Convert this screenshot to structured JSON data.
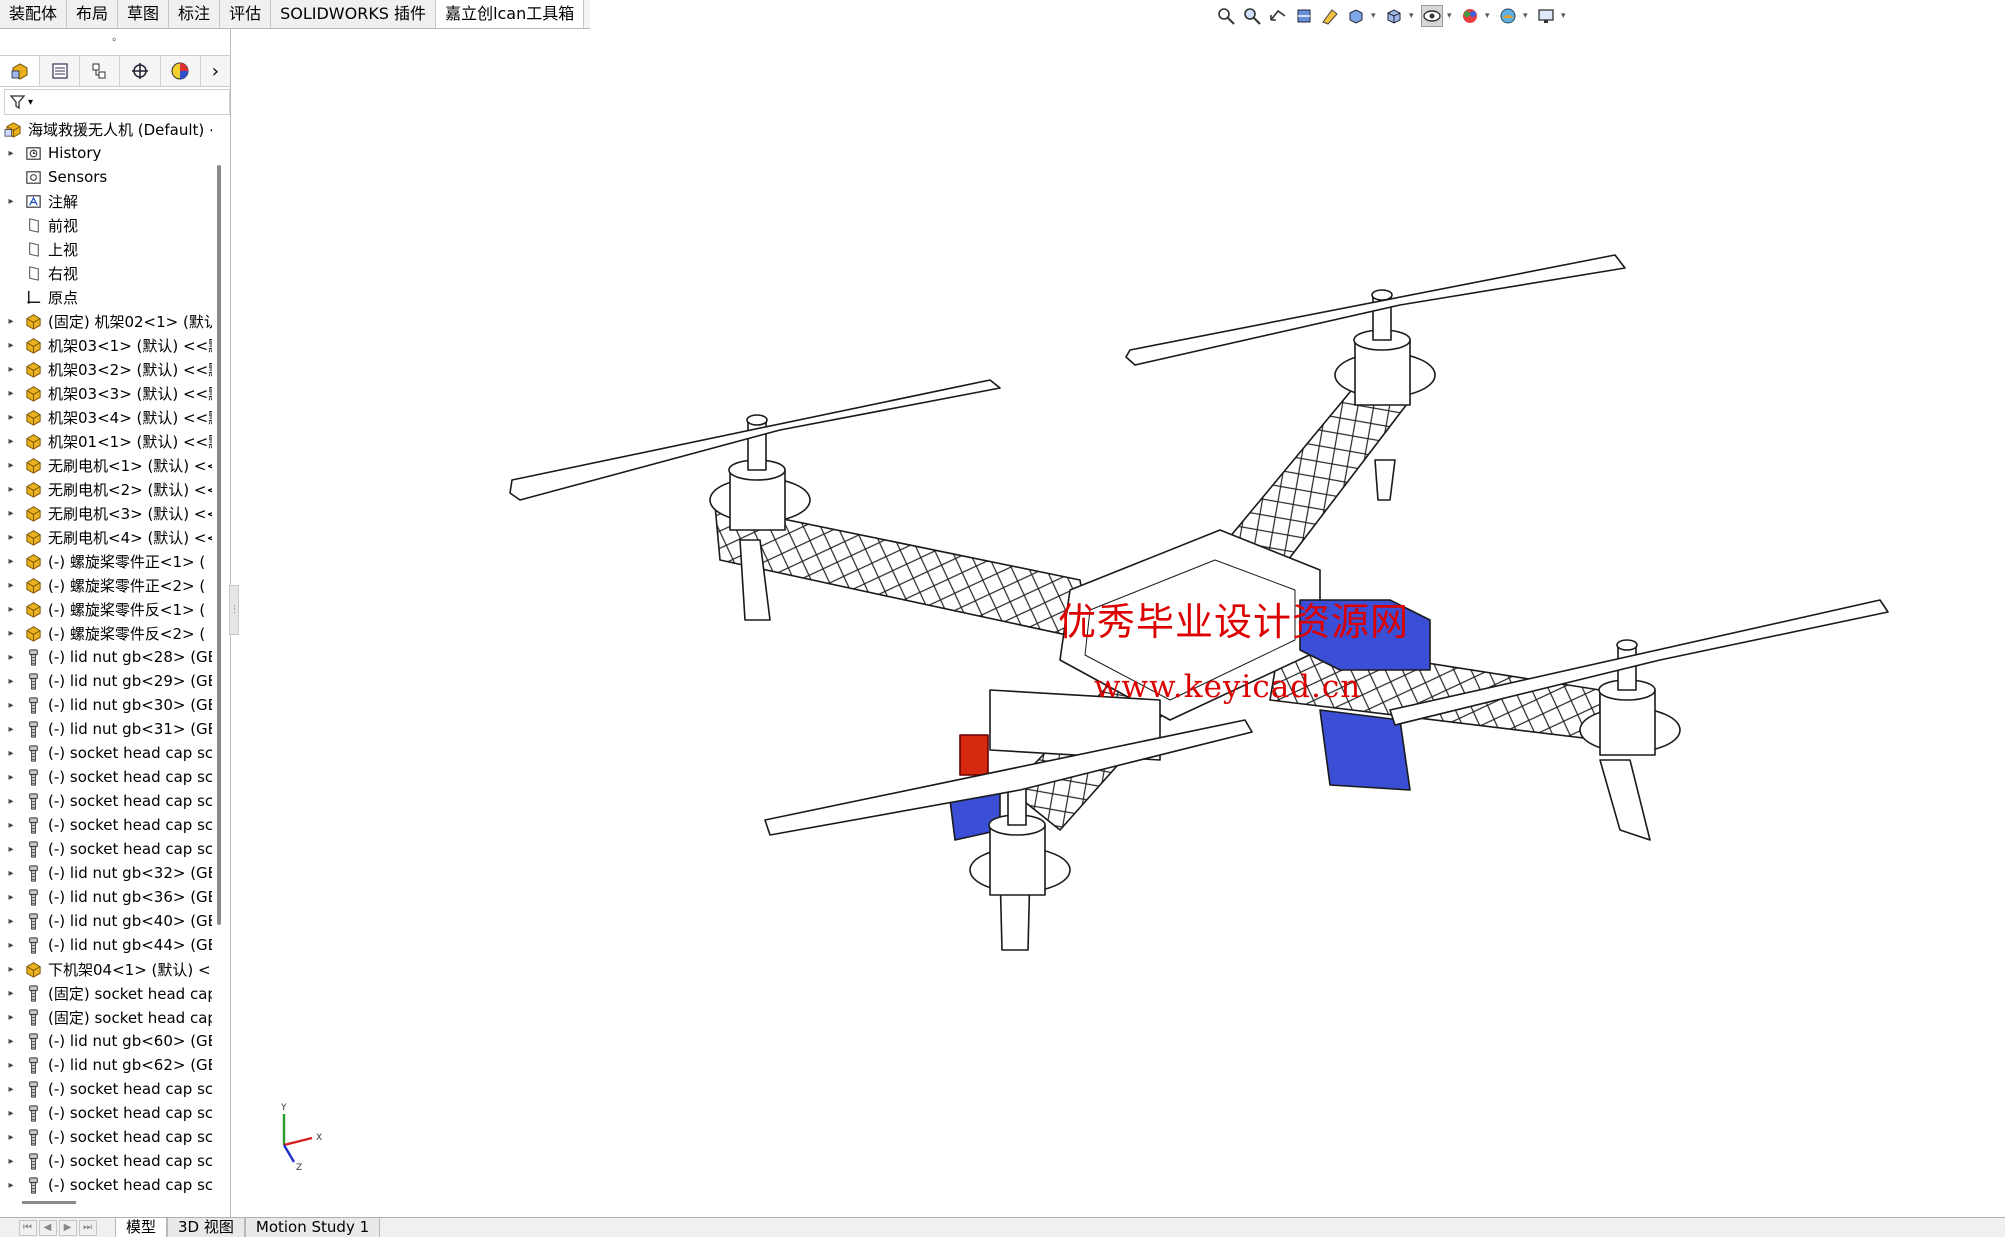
{
  "command_tabs": [
    {
      "label": "装配体"
    },
    {
      "label": "布局"
    },
    {
      "label": "草图"
    },
    {
      "label": "标注"
    },
    {
      "label": "评估"
    },
    {
      "label": "SOLIDWORKS 插件"
    },
    {
      "label": "嘉立创lcan工具箱"
    }
  ],
  "active_command_tab": 6,
  "heads_up_toolbar": [
    "zoom-to-fit-icon",
    "zoom-to-area-icon",
    "previous-view-icon",
    "section-view-icon",
    "dynamic-annotation-icon",
    "view-orientation-icon",
    "display-style-icon",
    "hide-show-items-icon",
    "edit-appearance-icon",
    "apply-scene-icon",
    "view-settings-icon"
  ],
  "manager_tabs": [
    "featuremanager-icon",
    "propertymanager-icon",
    "configurationmanager-icon",
    "dimxpertmanager-icon",
    "displaymanager-icon"
  ],
  "tree": {
    "root": "海域救援无人机 (Default) <",
    "items": [
      {
        "label": "History",
        "icon": "history",
        "expand": true
      },
      {
        "label": "Sensors",
        "icon": "sensors",
        "expand": false
      },
      {
        "label": "注解",
        "icon": "annotation",
        "expand": true
      },
      {
        "label": "前视",
        "icon": "plane",
        "expand": false
      },
      {
        "label": "上视",
        "icon": "plane",
        "expand": false
      },
      {
        "label": "右视",
        "icon": "plane",
        "expand": false
      },
      {
        "label": "原点",
        "icon": "origin",
        "expand": false
      },
      {
        "label": "(固定) 机架02<1> (默认",
        "icon": "part",
        "expand": true
      },
      {
        "label": "机架03<1> (默认) <<默",
        "icon": "part",
        "expand": true
      },
      {
        "label": "机架03<2> (默认) <<默",
        "icon": "part",
        "expand": true
      },
      {
        "label": "机架03<3> (默认) <<默",
        "icon": "part",
        "expand": true
      },
      {
        "label": "机架03<4> (默认) <<默",
        "icon": "part",
        "expand": true
      },
      {
        "label": "机架01<1> (默认) <<默",
        "icon": "part",
        "expand": true
      },
      {
        "label": "无刷电机<1> (默认) <<",
        "icon": "part",
        "expand": true
      },
      {
        "label": "无刷电机<2> (默认) <<",
        "icon": "part",
        "expand": true
      },
      {
        "label": "无刷电机<3> (默认) <<",
        "icon": "part",
        "expand": true
      },
      {
        "label": "无刷电机<4> (默认) <<",
        "icon": "part",
        "expand": true
      },
      {
        "label": "(-) 螺旋桨零件正<1> (",
        "icon": "part",
        "expand": true
      },
      {
        "label": "(-) 螺旋桨零件正<2> (",
        "icon": "part",
        "expand": true
      },
      {
        "label": "(-) 螺旋桨零件反<1> (",
        "icon": "part",
        "expand": true
      },
      {
        "label": "(-) 螺旋桨零件反<2> (",
        "icon": "part",
        "expand": true
      },
      {
        "label": "(-) lid nut gb<28> (GB",
        "icon": "toolbox",
        "expand": true
      },
      {
        "label": "(-) lid nut gb<29> (GB",
        "icon": "toolbox",
        "expand": true
      },
      {
        "label": "(-) lid nut gb<30> (GB",
        "icon": "toolbox",
        "expand": true
      },
      {
        "label": "(-) lid nut gb<31> (GB",
        "icon": "toolbox",
        "expand": true
      },
      {
        "label": "(-) socket head cap sc",
        "icon": "toolbox",
        "expand": true
      },
      {
        "label": "(-) socket head cap sc",
        "icon": "toolbox",
        "expand": true
      },
      {
        "label": "(-) socket head cap sc",
        "icon": "toolbox",
        "expand": true
      },
      {
        "label": "(-) socket head cap sc",
        "icon": "toolbox",
        "expand": true
      },
      {
        "label": "(-) socket head cap sc",
        "icon": "toolbox",
        "expand": true
      },
      {
        "label": "(-) lid nut gb<32> (GB",
        "icon": "toolbox",
        "expand": true
      },
      {
        "label": "(-) lid nut gb<36> (GB",
        "icon": "toolbox",
        "expand": true
      },
      {
        "label": "(-) lid nut gb<40> (GB",
        "icon": "toolbox",
        "expand": true
      },
      {
        "label": "(-) lid nut gb<44> (GB",
        "icon": "toolbox",
        "expand": true
      },
      {
        "label": "下机架04<1> (默认) <<",
        "icon": "part",
        "expand": true
      },
      {
        "label": "(固定) socket head cap",
        "icon": "toolbox",
        "expand": true
      },
      {
        "label": "(固定) socket head cap",
        "icon": "toolbox",
        "expand": true
      },
      {
        "label": "(-) lid nut gb<60> (GB",
        "icon": "toolbox",
        "expand": true
      },
      {
        "label": "(-) lid nut gb<62> (GB",
        "icon": "toolbox",
        "expand": true
      },
      {
        "label": "(-) socket head cap sc",
        "icon": "toolbox",
        "expand": true
      },
      {
        "label": "(-) socket head cap sc",
        "icon": "toolbox",
        "expand": true
      },
      {
        "label": "(-) socket head cap sc",
        "icon": "toolbox",
        "expand": true
      },
      {
        "label": "(-) socket head cap sc",
        "icon": "toolbox",
        "expand": true
      },
      {
        "label": "(-) socket head cap sc",
        "icon": "toolbox",
        "expand": true
      }
    ]
  },
  "bottom_tabs": [
    {
      "label": "模型"
    },
    {
      "label": "3D 视图"
    },
    {
      "label": "Motion Study 1"
    }
  ],
  "active_bottom_tab": 0,
  "watermark": {
    "line1": "优秀毕业设计资源网",
    "line2": "www.keyicad.cn"
  },
  "triad": {
    "x_label": "X",
    "y_label": "Y",
    "z_label": "Z"
  },
  "colors": {
    "watermark": "#dd0000",
    "battery_blue": "#3a4fd6",
    "part_icon_yellow": "#e9b020",
    "triad_x": "#d62020",
    "triad_y": "#2a9a2a",
    "triad_z": "#2030c8"
  }
}
